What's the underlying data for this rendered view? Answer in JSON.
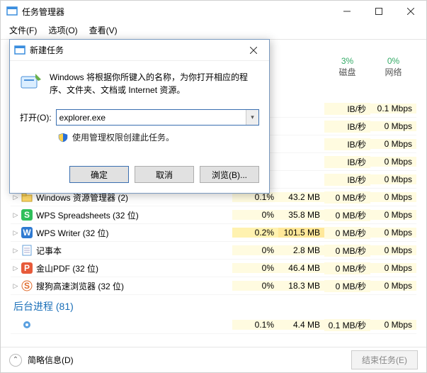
{
  "window": {
    "title": "任务管理器"
  },
  "menu": {
    "file": "文件(F)",
    "options": "选项(O)",
    "view": "查看(V)"
  },
  "columns": {
    "disk": {
      "pct": "3%",
      "label": "磁盘"
    },
    "net": {
      "pct": "0%",
      "label": "网络"
    }
  },
  "dialog": {
    "title": "新建任务",
    "message": "Windows 将根据你所键入的名称，为你打开相应的程序、文件夹、文档或 Internet 资源。",
    "open_label": "打开(O):",
    "open_value": "explorer.exe",
    "admin_text": "使用管理权限创建此任务。",
    "ok": "确定",
    "cancel": "取消",
    "browse": "浏览(B)..."
  },
  "section": "后台进程 (81)",
  "footer": {
    "simple": "简略信息(D)",
    "end": "结束任务(E)"
  },
  "rows": [
    {
      "name": "",
      "cpu": "",
      "mem": "",
      "disk": "IB/秒",
      "net": "0.1 Mbps",
      "cpu_cls": "",
      "mem_cls": "",
      "icon": "none"
    },
    {
      "name": "",
      "cpu": "",
      "mem": "",
      "disk": "IB/秒",
      "net": "0 Mbps",
      "cpu_cls": "",
      "mem_cls": "",
      "icon": "none"
    },
    {
      "name": "",
      "cpu": "",
      "mem": "",
      "disk": "IB/秒",
      "net": "0 Mbps",
      "cpu_cls": "",
      "mem_cls": "",
      "icon": "none"
    },
    {
      "name": "",
      "cpu": "",
      "mem": "",
      "disk": "IB/秒",
      "net": "0 Mbps",
      "cpu_cls": "",
      "mem_cls": "",
      "icon": "none"
    },
    {
      "name": "",
      "cpu": "",
      "mem": "",
      "disk": "IB/秒",
      "net": "0 Mbps",
      "cpu_cls": "",
      "mem_cls": "",
      "icon": "none"
    },
    {
      "name": "Windows 资源管理器 (2)",
      "cpu": "0.1%",
      "mem": "43.2 MB",
      "disk": "0 MB/秒",
      "net": "0 Mbps",
      "cpu_cls": "cpu-l",
      "mem_cls": "mem-l",
      "icon": "folder"
    },
    {
      "name": "WPS Spreadsheets (32 位)",
      "cpu": "0%",
      "mem": "35.8 MB",
      "disk": "0 MB/秒",
      "net": "0 Mbps",
      "cpu_cls": "cpu-l",
      "mem_cls": "mem-l",
      "icon": "wps-s"
    },
    {
      "name": "WPS Writer (32 位)",
      "cpu": "0.2%",
      "mem": "101.5 MB",
      "disk": "0 MB/秒",
      "net": "0 Mbps",
      "cpu_cls": "cpu-m",
      "mem_cls": "mem-m",
      "icon": "wps-w"
    },
    {
      "name": "记事本",
      "cpu": "0%",
      "mem": "2.8 MB",
      "disk": "0 MB/秒",
      "net": "0 Mbps",
      "cpu_cls": "cpu-l",
      "mem_cls": "mem-l",
      "icon": "notepad"
    },
    {
      "name": "金山PDF (32 位)",
      "cpu": "0%",
      "mem": "46.4 MB",
      "disk": "0 MB/秒",
      "net": "0 Mbps",
      "cpu_cls": "cpu-l",
      "mem_cls": "mem-l",
      "icon": "pdf"
    },
    {
      "name": "搜狗高速浏览器 (32 位)",
      "cpu": "0%",
      "mem": "18.3 MB",
      "disk": "0 MB/秒",
      "net": "0 Mbps",
      "cpu_cls": "cpu-l",
      "mem_cls": "mem-l",
      "icon": "sogou"
    }
  ],
  "bg_rows": [
    {
      "name": "",
      "cpu": "0.1%",
      "mem": "4.4 MB",
      "disk": "0.1 MB/秒",
      "net": "0 Mbps",
      "cpu_cls": "cpu-l",
      "mem_cls": "mem-l",
      "icon": "gear"
    }
  ]
}
